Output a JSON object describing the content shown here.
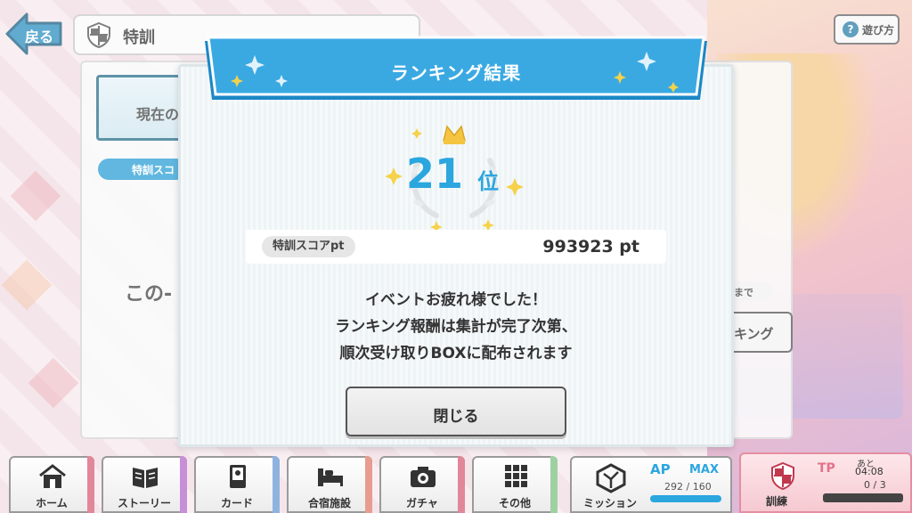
{
  "header": {
    "back_label": "戻る",
    "title": "特訓",
    "help_label": "遊び方"
  },
  "underlay": {
    "current_label": "現在の",
    "score_tag": "特訓スコ",
    "body_text_fragment": "この-",
    "deadline_fragment": "まで",
    "ranking_fragment": "キング"
  },
  "modal": {
    "title": "ランキング結果",
    "rank": "21",
    "rank_suffix": "位",
    "score_label": "特訓スコアpt",
    "score_value": "993923 pt",
    "message_lines": [
      "イベントお疲れ様でした！",
      "ランキング報酬は集計が完了次第、",
      "順次受け取りBOXに配布されます"
    ],
    "close_label": "閉じる"
  },
  "nav": {
    "items": [
      {
        "label": "ホーム",
        "icon": "home-icon",
        "accent": "#e2879a"
      },
      {
        "label": "ストーリー",
        "icon": "book-icon",
        "accent": "#c68fd6"
      },
      {
        "label": "カード",
        "icon": "card-icon",
        "accent": "#8fb3e0"
      },
      {
        "label": "合宿施設",
        "icon": "bed-icon",
        "accent": "#e79c8f"
      },
      {
        "label": "ガチャ",
        "icon": "camera-icon",
        "accent": "#e2879a"
      },
      {
        "label": "その他",
        "icon": "grid-icon",
        "accent": "#9fd0a2"
      }
    ],
    "mission": {
      "label": "ミッション",
      "icon": "mission-icon",
      "ap_label": "AP",
      "ap_max": "MAX",
      "ap_count": "292 / 160",
      "ap_fill_ratio": 1.0
    },
    "training": {
      "label": "訓練",
      "icon": "shield-icon",
      "tp_label": "TP",
      "remain_label": "あと",
      "time": "04:08",
      "count": "0 / 3"
    }
  },
  "colors": {
    "accent_blue": "#2ba6df",
    "ribbon_blue": "#3aa9e2",
    "gold": "#f5c542"
  }
}
